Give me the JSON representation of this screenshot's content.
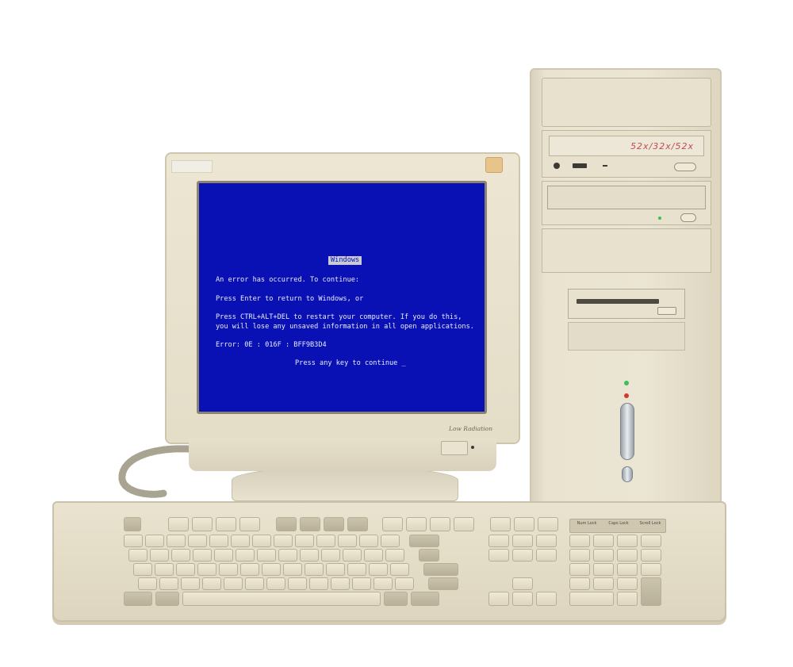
{
  "tower": {
    "cd_speed": "52x/32x/52x"
  },
  "monitor": {
    "label": "Low Radiation",
    "bsod": {
      "title": "Windows",
      "line1": "An error has occurred. To continue:",
      "line2": "Press Enter to return to Windows, or",
      "line3": "Press CTRL+ALT+DEL to restart your computer. If you do this,",
      "line4": "you will lose any unsaved information in all open applications.",
      "line5": "Error: 0E : 016F : BFF9B3D4",
      "line6": "Press any key to continue _"
    }
  },
  "keyboard": {
    "leds": [
      "Num Lock",
      "Caps Lock",
      "Scroll Lock"
    ]
  },
  "colors": {
    "screen_blue": "#0a11b4",
    "beige": "#e8e2cf",
    "led_green": "#3bbf5a",
    "led_red": "#d23a2e"
  }
}
